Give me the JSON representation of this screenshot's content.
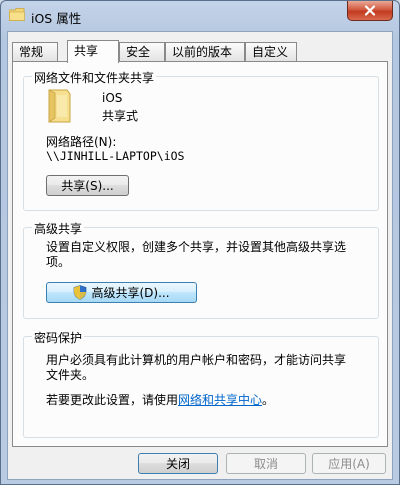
{
  "window": {
    "title": "iOS 属性"
  },
  "tabs": [
    {
      "label": "常规",
      "active": false
    },
    {
      "label": "共享",
      "active": true
    },
    {
      "label": "安全",
      "active": false
    },
    {
      "label": "以前的版本",
      "active": false
    },
    {
      "label": "自定义",
      "active": false
    }
  ],
  "network_share": {
    "group_title": "网络文件和文件夹共享",
    "folder_name": "iOS",
    "share_status": "共享式",
    "path_label": "网络路径(N):",
    "path_value": "\\\\JINHILL-LAPTOP\\iOS",
    "share_button": "共享(S)..."
  },
  "advanced_share": {
    "group_title": "高级共享",
    "description_line1": "设置自定义权限，创建多个共享，并设置其他高级共享选",
    "description_line2": "项。",
    "button": "高级共享(D)..."
  },
  "password": {
    "group_title": "密码保护",
    "text_line1": "用户必须具有此计算机的用户帐户和密码，才能访问共享",
    "text_line2": "文件夹。",
    "change_text": "若要更改此设置，请使用",
    "link_text": "网络和共享中心",
    "suffix": "。"
  },
  "footer": {
    "close": "关闭",
    "cancel": "取消",
    "apply": "应用(A)"
  },
  "colors": {
    "link": "#0066cc",
    "titlebar": "#b9cbe2",
    "close_button": "#c23a1f"
  }
}
